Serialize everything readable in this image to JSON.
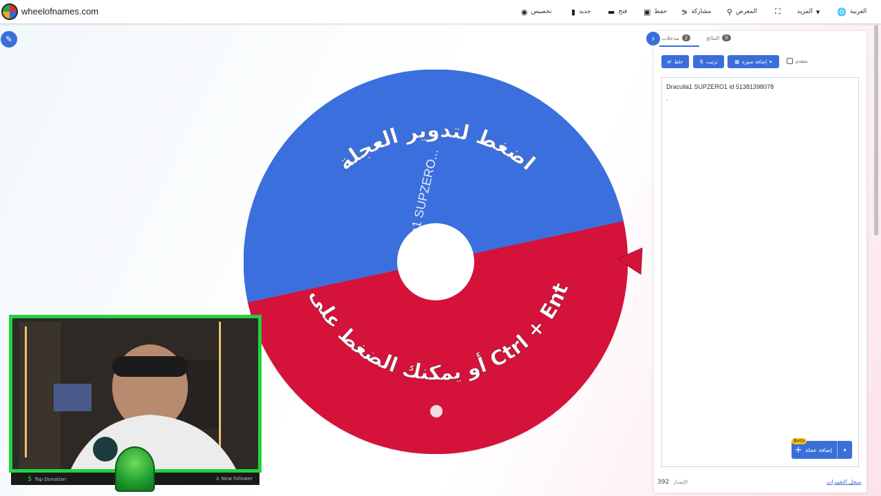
{
  "site": {
    "name": "wheelofnames.com"
  },
  "nav": [
    {
      "label": "العربية",
      "icon": "globe-icon"
    },
    {
      "label": "المزيد",
      "icon": "caret-down-icon"
    },
    {
      "label": "",
      "icon": "fullscreen-icon"
    },
    {
      "label": "المعرض",
      "icon": "search-icon"
    },
    {
      "label": "مشاركة",
      "icon": "share-icon"
    },
    {
      "label": "حفظ",
      "icon": "save-icon"
    },
    {
      "label": "فتح",
      "icon": "folder-open-icon"
    },
    {
      "label": "جديد",
      "icon": "file-icon"
    },
    {
      "label": "تخصيص",
      "icon": "palette-icon"
    }
  ],
  "wheel": {
    "segments": [
      {
        "label": "Draculla1 SUPZERO...",
        "color": "#3b6fde"
      },
      {
        "label": ".",
        "color": "#d4123a"
      }
    ],
    "overlay_line1": "اضغط لتدوير العجلة",
    "overlay_line2": "أو يمكنك الضغط على زر Ctrl + Enter",
    "pointer_color": "#d4123a"
  },
  "panel": {
    "tabs": [
      {
        "label": "مدخلات",
        "count": "2"
      },
      {
        "label": "النتائج",
        "count": "0"
      }
    ],
    "buttons": {
      "shuffle": "خلط",
      "sort": "ترتيب",
      "add_image": "إضافة صورة",
      "advanced": "متقدم"
    },
    "entries": [
      "Draculla1 SUPZERO1 id 51381398078",
      "."
    ],
    "add_wheel": {
      "label": "إضافة عجلة",
      "badge": "Beta"
    },
    "version_label": "الإصدار",
    "version": "392",
    "changelog": "سجل التغييرات"
  },
  "webcam": {
    "bottom_left": "Top Donation",
    "bottom_right": "New follower"
  }
}
